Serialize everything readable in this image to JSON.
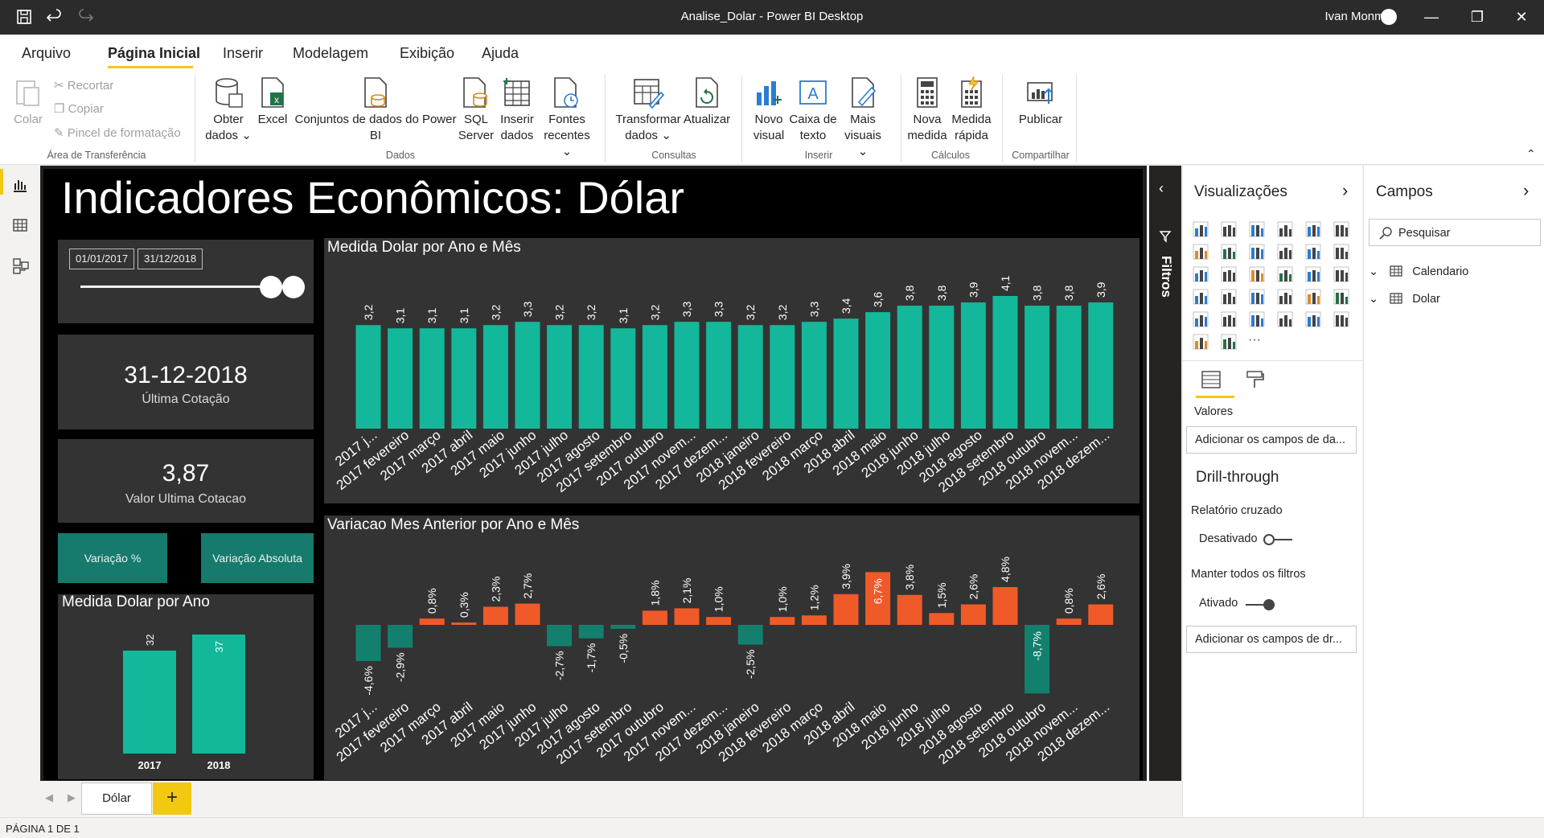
{
  "window": {
    "title": "Analise_Dolar - Power BI Desktop",
    "user": "Ivan Monma"
  },
  "menu_tabs": [
    "Arquivo",
    "Página Inicial",
    "Inserir",
    "Modelagem",
    "Exibição",
    "Ajuda"
  ],
  "ribbon": {
    "colar": "Colar",
    "recortar": "Recortar",
    "copiar": "Copiar",
    "pincel": "Pincel de formatação",
    "group_transfer": "Área de Transferência",
    "obter1": "Obter",
    "obter2": "dados",
    "excel": "Excel",
    "conjuntos1": "Conjuntos de dados do Power",
    "conjuntos2": "BI",
    "sql1": "SQL",
    "sql2": "Server",
    "inserir1": "Inserir",
    "inserir2": "dados",
    "fontes1": "Fontes",
    "fontes2": "recentes",
    "group_dados": "Dados",
    "transf1": "Transformar",
    "transf2": "dados",
    "atualizar": "Atualizar",
    "group_consultas": "Consultas",
    "novo1": "Novo",
    "novo2": "visual",
    "caixa1": "Caixa de",
    "caixa2": "texto",
    "mais1": "Mais",
    "mais2": "visuais",
    "group_inserir": "Inserir",
    "nova1": "Nova",
    "nova2": "medida",
    "rapida1": "Medida",
    "rapida2": "rápida",
    "group_calculos": "Cálculos",
    "publicar": "Publicar",
    "group_compartilhar": "Compartilhar"
  },
  "report": {
    "title": "Indicadores Econômicos: Dólar",
    "date_start": "01/01/2017",
    "date_end": "31/12/2018",
    "kpi1_value": "31-12-2018",
    "kpi1_label": "Última Cotação",
    "kpi2_value": "3,87",
    "kpi2_label": "Valor Ultima Cotacao",
    "btn_pct": "Variação %",
    "btn_abs": "Variação Absoluta"
  },
  "chart_data": [
    {
      "type": "bar",
      "title": "Medida Dolar por Ano e Mês",
      "categories": [
        "2017 j...",
        "2017 fevereiro",
        "2017 março",
        "2017 abril",
        "2017 maio",
        "2017 junho",
        "2017 julho",
        "2017 agosto",
        "2017 setembro",
        "2017 outubro",
        "2017 novem...",
        "2017 dezem...",
        "2018 janeiro",
        "2018 fevereiro",
        "2018 março",
        "2018 abril",
        "2018 maio",
        "2018 junho",
        "2018 julho",
        "2018 agosto",
        "2018 setembro",
        "2018 outubro",
        "2018 novem...",
        "2018 dezem..."
      ],
      "values": [
        3.2,
        3.1,
        3.1,
        3.1,
        3.2,
        3.3,
        3.2,
        3.2,
        3.1,
        3.2,
        3.3,
        3.3,
        3.2,
        3.2,
        3.3,
        3.4,
        3.6,
        3.8,
        3.8,
        3.9,
        4.1,
        3.8,
        3.8,
        3.9
      ],
      "labels": [
        "3,2",
        "3,1",
        "3,1",
        "3,1",
        "3,2",
        "3,3",
        "3,2",
        "3,2",
        "3,1",
        "3,2",
        "3,3",
        "3,3",
        "3,2",
        "3,2",
        "3,3",
        "3,4",
        "3,6",
        "3,8",
        "3,8",
        "3,9",
        "4,1",
        "3,8",
        "3,8",
        "3,9"
      ],
      "color": "#12b899"
    },
    {
      "type": "bar",
      "title": "Variacao Mes Anterior por Ano e Mês",
      "categories": [
        "2017 j...",
        "2017 fevereiro",
        "2017 março",
        "2017 abril",
        "2017 maio",
        "2017 junho",
        "2017 julho",
        "2017 agosto",
        "2017 setembro",
        "2017 outubro",
        "2017 novem...",
        "2017 dezem...",
        "2018 janeiro",
        "2018 fevereiro",
        "2018 março",
        "2018 abril",
        "2018 maio",
        "2018 junho",
        "2018 julho",
        "2018 agosto",
        "2018 setembro",
        "2018 outubro",
        "2018 novem...",
        "2018 dezem..."
      ],
      "values": [
        -4.6,
        -2.9,
        0.8,
        0.3,
        2.3,
        2.7,
        -2.7,
        -1.7,
        -0.5,
        1.8,
        2.1,
        1.0,
        -2.5,
        1.0,
        1.2,
        3.9,
        6.7,
        3.8,
        1.5,
        2.6,
        4.8,
        -8.7,
        0.8,
        2.6
      ],
      "labels": [
        "-4,6%",
        "-2,9%",
        "0,8%",
        "0,3%",
        "2,3%",
        "2,7%",
        "-2,7%",
        "-1,7%",
        "-0,5%",
        "1,8%",
        "2,1%",
        "1,0%",
        "-2,5%",
        "1,0%",
        "1,2%",
        "3,9%",
        "6,7%",
        "3,8%",
        "1,5%",
        "2,6%",
        "4,8%",
        "-8,7%",
        "0,8%",
        "2,6%"
      ],
      "positive_color": "#f05a28",
      "negative_color": "#13806e"
    },
    {
      "type": "bar",
      "title": "Medida Dolar por Ano",
      "categories": [
        "2017",
        "2018"
      ],
      "values": [
        32,
        37
      ],
      "labels": [
        "32",
        "37"
      ],
      "color": "#12b899"
    }
  ],
  "filtros": "Filtros",
  "viz_pane": {
    "title": "Visualizações",
    "valores": "Valores",
    "add_fields": "Adicionar os campos de da...",
    "drill_title": "Drill-through",
    "relatorio": "Relatório cruzado",
    "desativado": "Desativado",
    "manter": "Manter todos os filtros",
    "ativado": "Ativado",
    "add_drill": "Adicionar os campos de dr..."
  },
  "fields_pane": {
    "title": "Campos",
    "search_placeholder": "Pesquisar",
    "tables": [
      "Calendario",
      "Dolar"
    ]
  },
  "page_tabs": {
    "page": "Dólar",
    "add": "+"
  },
  "status": "PÁGINA 1 DE 1",
  "colors": {
    "accent": "#f2c811",
    "teal": "#12b899",
    "orange": "#f05a28"
  }
}
